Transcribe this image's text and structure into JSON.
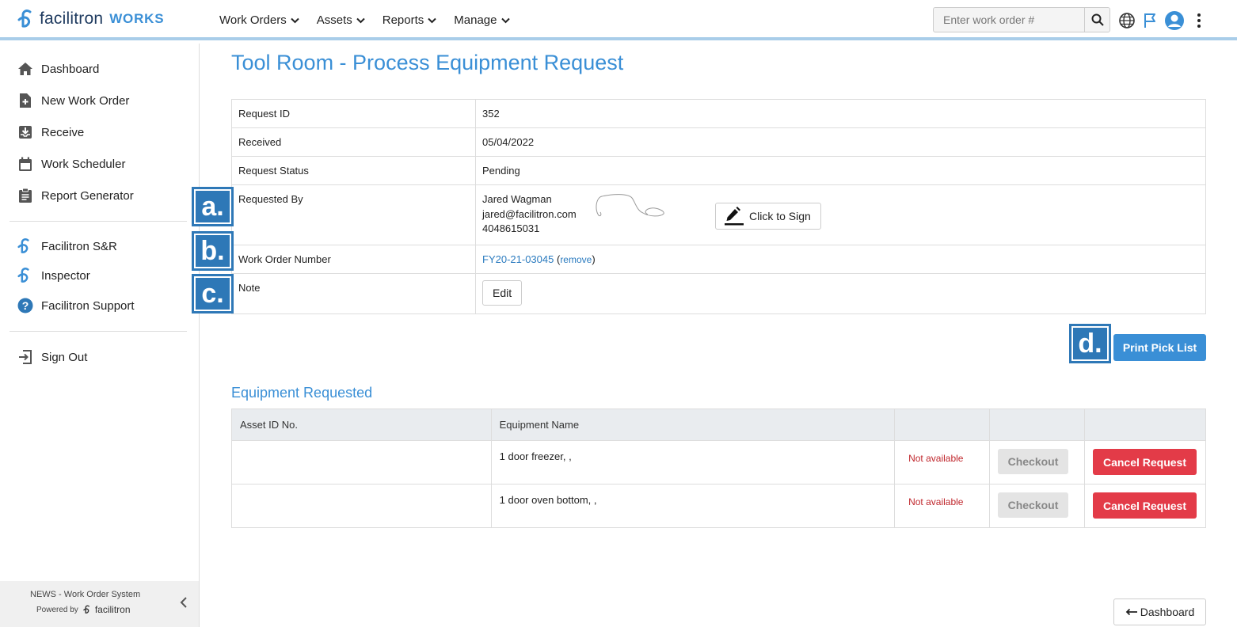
{
  "header": {
    "logo_text": "facilitron",
    "logo_suffix": "WORKS",
    "nav": [
      "Work Orders",
      "Assets",
      "Reports",
      "Manage"
    ],
    "search_placeholder": "Enter work order #"
  },
  "sidebar": {
    "items": [
      {
        "label": "Dashboard",
        "icon": "home-icon"
      },
      {
        "label": "New Work Order",
        "icon": "file-plus-icon"
      },
      {
        "label": "Receive",
        "icon": "inbox-download-icon"
      },
      {
        "label": "Work Scheduler",
        "icon": "calendar-icon"
      },
      {
        "label": "Report Generator",
        "icon": "clipboard-icon"
      },
      {
        "label": "Facilitron S&R",
        "icon": "facilitron-logo-icon"
      },
      {
        "label": "Inspector",
        "icon": "facilitron-logo-icon"
      },
      {
        "label": "Facilitron Support",
        "icon": "help-circle-icon"
      },
      {
        "label": "Sign Out",
        "icon": "sign-out-icon"
      }
    ],
    "footer_system": "NEWS - Work Order System",
    "footer_powered": "Powered by",
    "footer_brand": "facilitron"
  },
  "page": {
    "title": "Tool Room - Process Equipment Request",
    "details": {
      "request_id_label": "Request ID",
      "request_id": "352",
      "received_label": "Received",
      "received": "05/04/2022",
      "status_label": "Request Status",
      "status": "Pending",
      "requested_by_label": "Requested By",
      "requester_name": "Jared Wagman",
      "requester_email": "jared@facilitron.com",
      "requester_phone": "4048615031",
      "sign_button": "Click to Sign",
      "wo_label": "Work Order Number",
      "wo_number": "FY20-21-03045",
      "wo_remove": "remove",
      "note_label": "Note",
      "edit_button": "Edit"
    },
    "badges": {
      "a": "a.",
      "b": "b.",
      "c": "c.",
      "d": "d."
    },
    "print_button": "Print Pick List",
    "equipment_title": "Equipment Requested",
    "equipment_columns": [
      "Asset ID No.",
      "Equipment Name",
      "",
      "",
      ""
    ],
    "equipment_rows": [
      {
        "asset_id": "",
        "name": "1 door freezer, ,",
        "availability": "Not available",
        "checkout": "Checkout",
        "cancel": "Cancel Request"
      },
      {
        "asset_id": "",
        "name": "1 door oven bottom, ,",
        "availability": "Not available",
        "checkout": "Checkout",
        "cancel": "Cancel Request"
      }
    ],
    "back_button": "Dashboard"
  },
  "colors": {
    "brand_blue": "#3a8fd6",
    "badge_blue": "#2e78b7",
    "danger": "#e33b48",
    "not_available": "#c0272d"
  }
}
